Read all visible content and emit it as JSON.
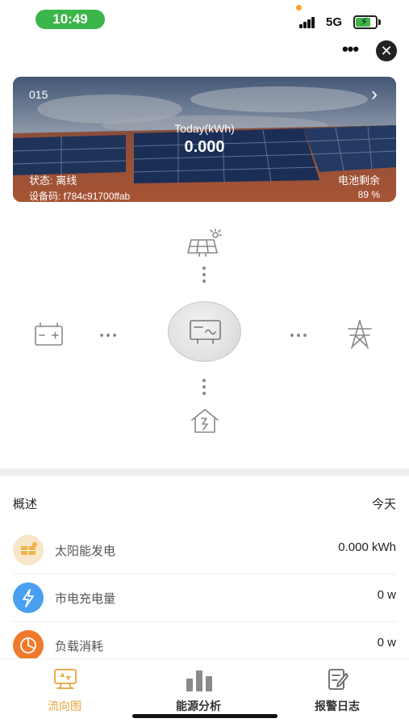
{
  "status_bar": {
    "time": "10:49",
    "network": "5G",
    "battery_icon": "battery-charging-icon"
  },
  "header": {
    "more_icon": "more-dots-icon",
    "close_icon": "close-icon"
  },
  "banner": {
    "device_id": "015",
    "today_label": "Today(kWh)",
    "today_value": "0.000",
    "state_text": "状态: 离线",
    "device_code": "设备码: f784c91700ffab",
    "battery_label": "电池剩余",
    "battery_value": "89 %"
  },
  "flow": {
    "nodes": [
      "solar-panel-icon",
      "battery-icon",
      "inverter-icon",
      "grid-tower-icon",
      "home-load-icon"
    ]
  },
  "summary": {
    "title": "概述",
    "period": "今天",
    "rows": [
      {
        "label": "太阳能发电",
        "value": "0.000 kWh",
        "icon": "solar-icon",
        "color": "#f8e6c9"
      },
      {
        "label": "市电充电量",
        "value": "0 w",
        "icon": "lightning-icon",
        "color": "#4a9ff0"
      },
      {
        "label": "负载消耗",
        "value": "0 w",
        "icon": "pie-chart-icon",
        "color": "#f07a2c"
      }
    ]
  },
  "tabs": [
    {
      "label": "流向图",
      "icon": "flow-chart-icon",
      "active": true
    },
    {
      "label": "能源分析",
      "icon": "bar-chart-icon",
      "active": false
    },
    {
      "label": "报警日志",
      "icon": "alarm-log-icon",
      "active": false
    }
  ],
  "colors": {
    "accent": "#e8a33c",
    "status_green": "#3cb54a"
  }
}
